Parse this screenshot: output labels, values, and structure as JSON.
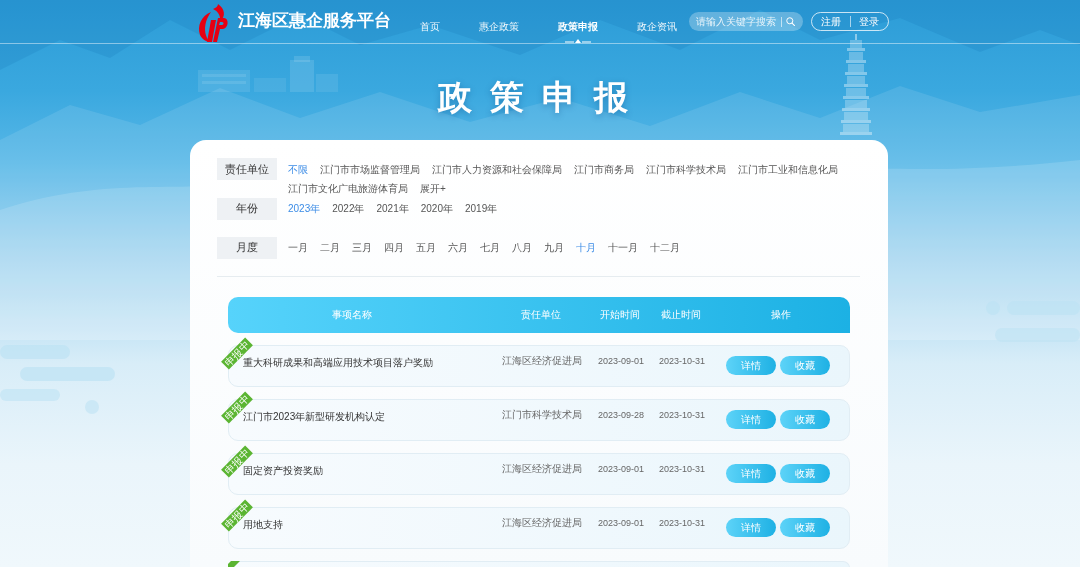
{
  "header": {
    "site_title": "江海区惠企服务平台",
    "nav": [
      {
        "label": "首页",
        "selected": false
      },
      {
        "label": "惠企政策",
        "selected": false
      },
      {
        "label": "政策申报",
        "selected": true
      },
      {
        "label": "政企资讯",
        "selected": false
      }
    ],
    "search": {
      "placeholder": "请输入关键字搜索"
    },
    "auth_buttons": [
      "注册",
      "登录"
    ]
  },
  "page_title": "政策申报",
  "filters": [
    {
      "label": "责任单位",
      "options": [
        {
          "label": "不限",
          "selected": true
        },
        {
          "label": "江门市市场监督管理局",
          "selected": false
        },
        {
          "label": "江门市人力资源和社会保障局",
          "selected": false
        },
        {
          "label": "江门市商务局",
          "selected": false
        },
        {
          "label": "江门市科学技术局",
          "selected": false
        },
        {
          "label": "江门市工业和信息化局",
          "selected": false
        },
        {
          "label": "江门市文化广电旅游体育局",
          "selected": false
        }
      ],
      "expand_link": "展开+"
    },
    {
      "label": "年份",
      "options": [
        {
          "label": "2023年",
          "selected": true
        },
        {
          "label": "2022年",
          "selected": false
        },
        {
          "label": "2021年",
          "selected": false
        },
        {
          "label": "2020年",
          "selected": false
        },
        {
          "label": "2019年",
          "selected": false
        }
      ]
    },
    {
      "label": "月度",
      "options": [
        {
          "label": "一月",
          "selected": false
        },
        {
          "label": "二月",
          "selected": false
        },
        {
          "label": "三月",
          "selected": false
        },
        {
          "label": "四月",
          "selected": false
        },
        {
          "label": "五月",
          "selected": false
        },
        {
          "label": "六月",
          "selected": false
        },
        {
          "label": "七月",
          "selected": false
        },
        {
          "label": "八月",
          "selected": false
        },
        {
          "label": "九月",
          "selected": false
        },
        {
          "label": "十月",
          "selected": true
        },
        {
          "label": "十一月",
          "selected": false
        },
        {
          "label": "十二月",
          "selected": false
        }
      ]
    }
  ],
  "table": {
    "columns": [
      "事项名称",
      "责任单位",
      "开始时间",
      "截止时间",
      "操作"
    ],
    "rows": [
      {
        "status": "申报中",
        "name": "重大科研成果和高端应用技术项目落户奖励",
        "unit": "江海区经济促进局",
        "start": "2023-09-01",
        "end": "2023-10-31",
        "actions": [
          "详情",
          "收藏"
        ]
      },
      {
        "status": "申报中",
        "name": "江门市2023年新型研发机构认定",
        "unit": "江门市科学技术局",
        "start": "2023-09-28",
        "end": "2023-10-31",
        "actions": [
          "详情",
          "收藏"
        ]
      },
      {
        "status": "申报中",
        "name": "固定资产投资奖励",
        "unit": "江海区经济促进局",
        "start": "2023-09-01",
        "end": "2023-10-31",
        "actions": [
          "详情",
          "收藏"
        ]
      },
      {
        "status": "申报中",
        "name": "用地支持",
        "unit": "江海区经济促进局",
        "start": "2023-09-01",
        "end": "2023-10-31",
        "actions": [
          "详情",
          "收藏"
        ]
      }
    ],
    "more_rows_below": true
  }
}
